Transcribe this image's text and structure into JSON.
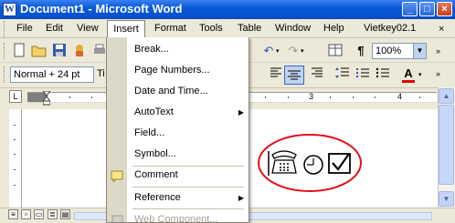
{
  "window": {
    "title": "Document1 - Microsoft Word",
    "app_icon_letter": "W",
    "controls": {
      "minimize": "_",
      "maximize": "□",
      "close": "×"
    }
  },
  "menubar": {
    "items": [
      "File",
      "Edit",
      "View",
      "Insert",
      "Format",
      "Tools",
      "Table",
      "Window",
      "Help",
      "Vietkey02.1"
    ]
  },
  "toolbar": {
    "zoom": "100%",
    "style": "Normal + 24 pt",
    "font_partial": "Ti"
  },
  "ruler": {
    "left_marker": "L",
    "numbers": [
      "3",
      "4"
    ]
  },
  "insert_menu": {
    "items": [
      {
        "label": "Break...",
        "submenu": false,
        "disabled": false
      },
      {
        "label": "Page Numbers...",
        "submenu": false,
        "disabled": false
      },
      {
        "label": "Date and Time...",
        "submenu": false,
        "disabled": false
      },
      {
        "label": "AutoText",
        "submenu": true,
        "disabled": false
      },
      {
        "label": "Field...",
        "submenu": false,
        "disabled": false
      },
      {
        "label": "Symbol...",
        "submenu": false,
        "disabled": false
      },
      {
        "label": "Comment",
        "submenu": false,
        "disabled": false
      },
      {
        "label": "Reference",
        "submenu": true,
        "disabled": false
      },
      {
        "label": "Web Component...",
        "submenu": false,
        "disabled": true
      }
    ],
    "submenu_arrow": "▶"
  },
  "document": {
    "symbol_icons": [
      "telephone-icon",
      "clock-icon",
      "checkbox-icon"
    ],
    "highlight_color": "#e0101a"
  },
  "colors": {
    "titlebar": "#0a5ad8",
    "menu_gutter": "#ddd9c9",
    "font_color_bar": "#e00000"
  }
}
